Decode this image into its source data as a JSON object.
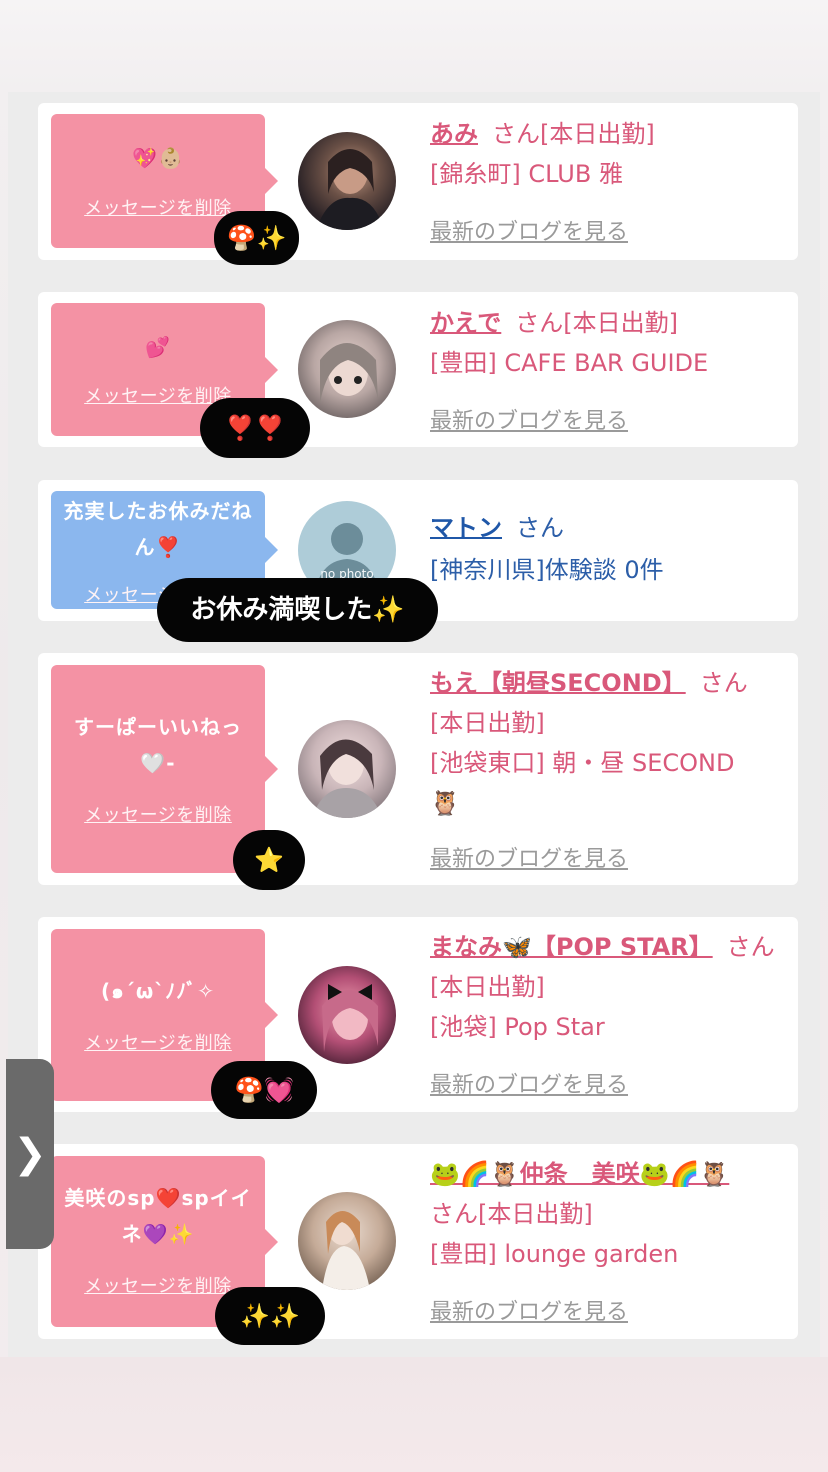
{
  "cards": [
    {
      "message": "💖👶🏼",
      "delete_label": "メッセージを削除",
      "reaction": "🍄✨",
      "name": "あみ",
      "san": "さん[本日出勤]",
      "shop": "[錦糸町] CLUB 雅",
      "blog": "最新のブログを見る"
    },
    {
      "message": "💕",
      "delete_label": "メッセージを削除",
      "reaction": "❣️❣️",
      "name": "かえで",
      "san": "さん[本日出勤]",
      "shop": "[豊田] CAFE BAR GUIDE",
      "blog": "最新のブログを見る"
    },
    {
      "message": "充実したお休みだねん❣️",
      "delete_label": "メッセージを削除",
      "reaction": "お休み満喫した✨",
      "avatar_label": "no photo",
      "name": "マトン",
      "san": "さん",
      "shop": "[神奈川県]体験談 0件"
    },
    {
      "message": "すーぱーいいねっ🤍-",
      "delete_label": "メッセージを削除",
      "reaction": "⭐",
      "name": "もえ【朝昼SECOND】",
      "san": "さん",
      "status": "[本日出勤]",
      "shop": "[池袋東口] 朝・昼 SECOND",
      "shop_extra": "🦉",
      "blog": "最新のブログを見る"
    },
    {
      "message": "(๑´ω`ﾉﾉﾞ✧",
      "delete_label": "メッセージを削除",
      "reaction": "🍄💓",
      "name": "まなみ🦋【POP STAR】",
      "san": "さん[本日出勤]",
      "shop": "[池袋] Pop Star",
      "blog": "最新のブログを見る"
    },
    {
      "message": "美咲のsp❤️spイイネ💜✨",
      "delete_label": "メッセージを削除",
      "reaction": "✨✨",
      "name": "🐸🌈🦉仲条　美咲🐸🌈🦉",
      "san": "さん[本日出勤]",
      "shop": "[豊田] lounge garden",
      "blog": "最新のブログを見る"
    }
  ],
  "side_handle_icon": "chevron-right-icon",
  "side_handle_glyph": "❯"
}
